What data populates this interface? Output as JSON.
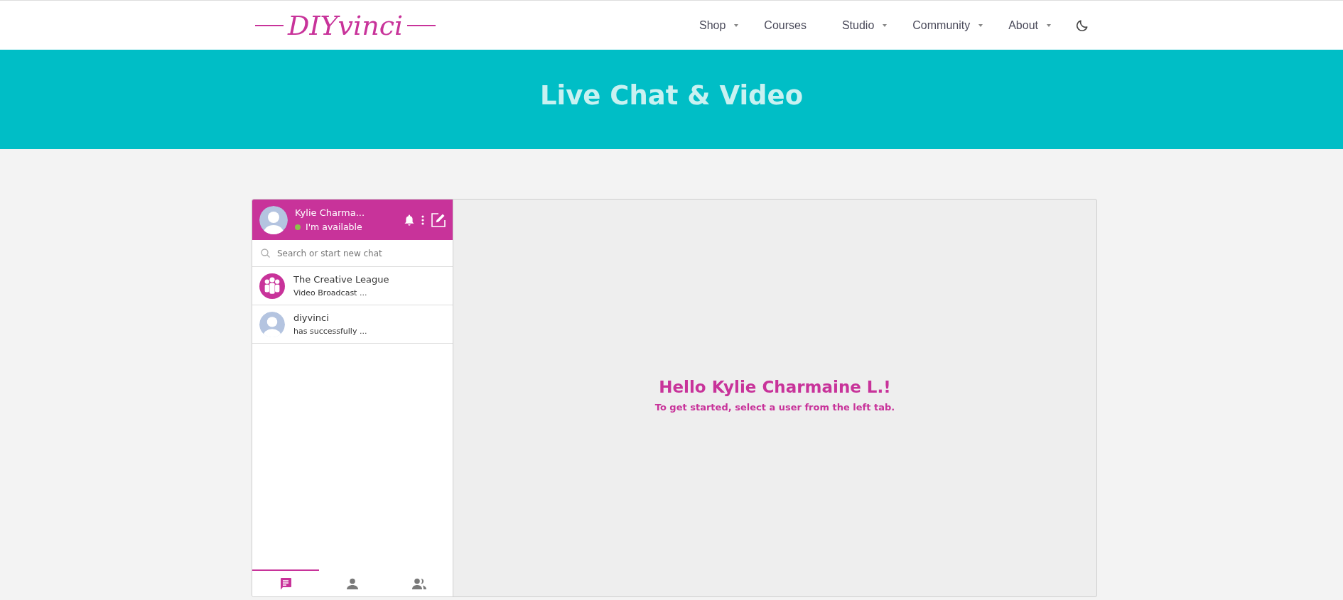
{
  "header": {
    "logo": "DIYvinci",
    "nav": [
      {
        "label": "Shop",
        "has_dropdown": true
      },
      {
        "label": "Courses",
        "has_dropdown": false
      },
      {
        "label": "Studio",
        "has_dropdown": true
      },
      {
        "label": "Community",
        "has_dropdown": true
      },
      {
        "label": "About",
        "has_dropdown": true
      }
    ]
  },
  "banner": {
    "title": "Live Chat & Video"
  },
  "chat": {
    "user": {
      "name": "Kylie Charma...",
      "status": "I'm available",
      "online": true
    },
    "search": {
      "placeholder": "Search or start new chat"
    },
    "conversations": [
      {
        "name": "The Creative League",
        "preview": "Video Broadcast ...",
        "kind": "group"
      },
      {
        "name": "diyvinci",
        "preview": "has successfully ...",
        "kind": "user"
      }
    ],
    "tabs": [
      {
        "kind": "chats",
        "selected": true
      },
      {
        "kind": "contacts",
        "selected": false
      },
      {
        "kind": "groups",
        "selected": false
      }
    ],
    "welcome": {
      "title": "Hello Kylie Charmaine L.!",
      "subtitle": "To get started, select a user from the left tab."
    }
  }
}
